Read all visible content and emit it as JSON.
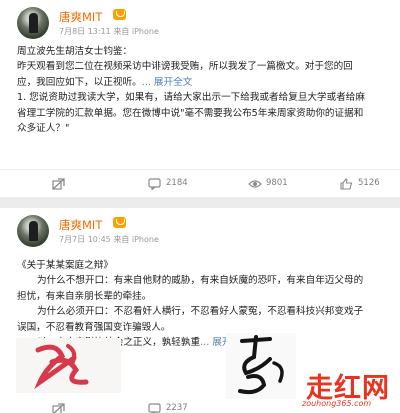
{
  "posts": [
    {
      "user": "唐爽MIT",
      "meta": "7月8日 13:11 来自 iPhone",
      "lines": [
        "周立波先生胡洁女士钧鉴：",
        "昨天观看到您二位在视频采访中诽谤我受贿，所以我发了一篇檄文。对于您的回",
        "应，我回应如下，以正视听。",
        "1. 您说资助过我读大学，如果有，请给大家出示一下给我或者给复旦大学或者给麻",
        "省理工学院的汇款单据。您在微博中说\"毫不需要我公布5年来周家资助你的证据和",
        "众多证人？\""
      ],
      "expand": "... 展开全文",
      "actions": {
        "repost": "",
        "comment": "2184",
        "read": "9801",
        "like": "5126"
      }
    },
    {
      "user": "唐爽MIT",
      "meta": "7月7日 10:45 来自 iPhone",
      "lines": [
        "《关于某某案庭之辩》",
        "为什么不想开口：有来自他财的威胁，有来自妖魔的恐吓，有来自年迈父母的",
        "担忧，有来自亲朋长辈的牵挂。",
        "为什么必须开口：不忍看奸人横行，不忍看好人蒙冤，不忍看科技兴邦变戏子",
        "误国，不忍看教育强国变诈骗毁人。",
        "以一人之安慰比社会之正义，孰轻孰重"
      ],
      "expand": "... 展开全文",
      "actions": {
        "repost": "",
        "comment": "2237"
      }
    }
  ],
  "watermark": {
    "title": "走红网",
    "url": "zouhong365.com"
  },
  "colors": {
    "username": "#f26b00",
    "link": "#4f7db5",
    "icon": "#8a8a8a"
  }
}
